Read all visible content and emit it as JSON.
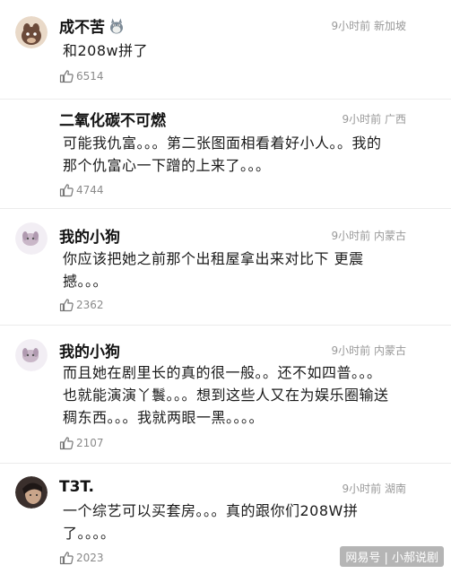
{
  "comments": [
    {
      "username": "成不苦",
      "meta": "9小时前 新加坡",
      "content": "和208w拼了",
      "likes": "6514"
    },
    {
      "username": "二氧化碳不可燃",
      "meta": "9小时前 广西",
      "content": "可能我仇富。。。第二张图面相看着好小人。。我的\n那个仇富心一下蹭的上来了。。。",
      "likes": "4744"
    },
    {
      "username": "我的小狗",
      "meta": "9小时前 内蒙古",
      "content": "你应该把她之前那个出租屋拿出来对比下 更震\n撼。。。",
      "likes": "2362"
    },
    {
      "username": "我的小狗",
      "meta": "9小时前 内蒙古",
      "content": "而且她在剧里长的真的很一般。。还不如四普。。。\n也就能演演丫鬟。。。想到这些人又在为娱乐圈输送\n稠东西。。。我就两眼一黑。。。。",
      "likes": "2107"
    },
    {
      "username": "T3T.",
      "meta": "9小时前 湖南",
      "content": "一个综艺可以买套房。。。真的跟你们208W拼\n了。。。。",
      "likes": "2023"
    }
  ],
  "icons": {
    "like": "thumbs-up-icon",
    "badge": "totoro-icon"
  },
  "watermark": "网易号 | 小郝说剧",
  "colors": {
    "meta": "#999999",
    "likes": "#8a8a8a",
    "divider": "#ececec"
  }
}
